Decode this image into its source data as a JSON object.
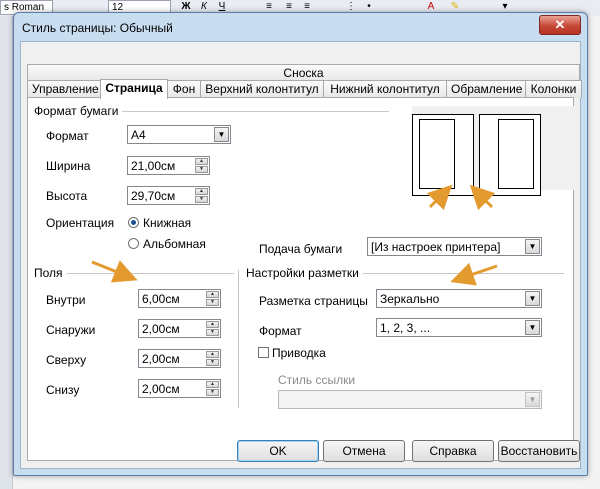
{
  "app": {
    "font_name": "s Roman",
    "font_size": "12",
    "bold_label": "Ж",
    "italic_label": "К",
    "underline_label": "Ч"
  },
  "dialog": {
    "title": "Стиль страницы: Обычный",
    "close_label": "✕"
  },
  "tabs_row1": [
    {
      "label": "Сноска"
    }
  ],
  "tabs_row2": [
    {
      "label": "Управление"
    },
    {
      "label": "Страница"
    },
    {
      "label": "Фон"
    },
    {
      "label": "Верхний колонтитул"
    },
    {
      "label": "Нижний колонтитул"
    },
    {
      "label": "Обрамление"
    },
    {
      "label": "Колонки"
    }
  ],
  "active_tab": "Страница",
  "paper_format": {
    "title": "Формат бумаги",
    "format_label": "Формат",
    "format_value": "A4",
    "width_label": "Ширина",
    "width_value": "21,00см",
    "height_label": "Высота",
    "height_value": "29,70см",
    "orientation_label": "Ориентация",
    "portrait_label": "Книжная",
    "landscape_label": "Альбомная",
    "orientation_selected": "portrait",
    "tray_label": "Подача бумаги",
    "tray_value": "[Из настроек принтера]"
  },
  "margins": {
    "title": "Поля",
    "inner_label": "Внутри",
    "inner_value": "6,00см",
    "outer_label": "Снаружи",
    "outer_value": "2,00см",
    "top_label": "Сверху",
    "top_value": "2,00см",
    "bottom_label": "Снизу",
    "bottom_value": "2,00см"
  },
  "layout": {
    "title": "Настройки разметки",
    "page_layout_label": "Разметка страницы",
    "page_layout_value": "Зеркально",
    "format_label": "Формат",
    "format_value": "1, 2, 3, ...",
    "register_label": "Приводка",
    "register_checked": false,
    "reference_style_label": "Стиль ссылки",
    "reference_style_value": ""
  },
  "buttons": {
    "ok": "OK",
    "cancel": "Отмена",
    "help": "Справка",
    "reset": "Восстановить"
  },
  "colors": {
    "annotation_arrow": "#e39a2e",
    "dialog_frame": "#c9ddf1"
  }
}
